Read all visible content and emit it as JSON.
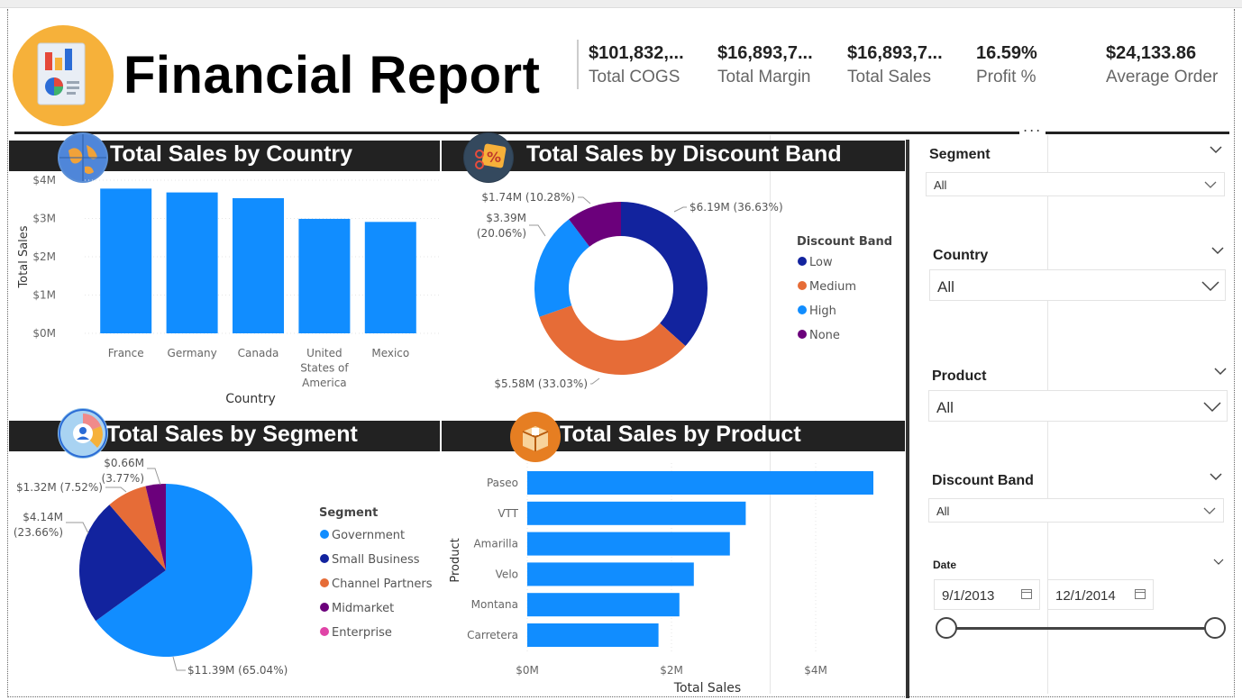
{
  "header": {
    "title": "Financial Report",
    "logo_icon": "report-icon"
  },
  "kpis": [
    {
      "value": "$101,832,...",
      "label": "Total COGS"
    },
    {
      "value": "$16,893,7...",
      "label": "Total Margin"
    },
    {
      "value": "$16,893,7...",
      "label": "Total Sales"
    },
    {
      "value": "16.59%",
      "label": "Profit %"
    },
    {
      "value": "$24,133.86",
      "label": "Average Order"
    }
  ],
  "panels": {
    "country": {
      "title": "Total Sales by Country",
      "icon": "globe-icon"
    },
    "discount": {
      "title": "Total Sales by Discount Band",
      "icon": "discount-tag-icon"
    },
    "segment": {
      "title": "Total Sales by Segment",
      "icon": "pie-user-icon"
    },
    "product": {
      "title": "Total Sales by Product",
      "icon": "box-icon"
    }
  },
  "more_options": "...",
  "colors": {
    "blue": "#118dff",
    "dark_blue": "#12239e",
    "orange": "#e66c37",
    "purple": "#6b007b",
    "pink": "#e044a7",
    "header_bar": "#222222",
    "logo_bg": "#f6b13a"
  },
  "chart_data": [
    {
      "type": "bar",
      "name": "country",
      "categories": [
        "France",
        "Germany",
        "Canada",
        "United States of America",
        "Mexico"
      ],
      "category_lines": [
        [
          "France"
        ],
        [
          "Germany"
        ],
        [
          "Canada"
        ],
        [
          "United",
          "States of",
          "America"
        ],
        [
          "Mexico"
        ]
      ],
      "values": [
        3.78,
        3.68,
        3.53,
        2.99,
        2.91
      ],
      "ylim": [
        0,
        4
      ],
      "yticks": [
        "$0M",
        "$1M",
        "$2M",
        "$3M",
        "$4M"
      ],
      "xlabel": "Country",
      "ylabel": "Total Sales",
      "grid": true
    },
    {
      "type": "pie",
      "name": "discount",
      "donut": true,
      "legend_title": "Discount Band",
      "slices": [
        {
          "name": "Low",
          "value": 6.19,
          "label": "$6.19M (36.63%)",
          "color": "#12239e"
        },
        {
          "name": "Medium",
          "value": 5.58,
          "label": "$5.58M (33.03%)",
          "color": "#e66c37"
        },
        {
          "name": "High",
          "value": 3.39,
          "label": "$3.39M (20.06%)",
          "color": "#118dff"
        },
        {
          "name": "None",
          "value": 1.74,
          "label": "$1.74M (10.28%)",
          "color": "#6b007b"
        }
      ],
      "legend_position": "right"
    },
    {
      "type": "pie",
      "name": "segment",
      "donut": false,
      "legend_title": "Segment",
      "slices": [
        {
          "name": "Government",
          "value": 11.39,
          "label": "$11.39M (65.04%)",
          "color": "#118dff"
        },
        {
          "name": "Small Business",
          "value": 4.14,
          "label": "$4.14M (23.66%)",
          "color": "#12239e"
        },
        {
          "name": "Channel Partners",
          "value": 1.32,
          "label": "$1.32M (7.52%)",
          "color": "#e66c37"
        },
        {
          "name": "Midmarket",
          "value": 0.66,
          "label": "$0.66M (3.77%)",
          "color": "#6b007b"
        },
        {
          "name": "Enterprise",
          "value": 0,
          "label": "",
          "color": "#e044a7"
        }
      ],
      "legend_position": "right"
    },
    {
      "type": "bar",
      "name": "product",
      "orientation": "horizontal",
      "categories": [
        "Paseo",
        "VTT",
        "Amarilla",
        "Velo",
        "Montana",
        "Carretera"
      ],
      "values": [
        4.8,
        3.03,
        2.81,
        2.31,
        2.11,
        1.82
      ],
      "xlim": [
        0,
        5
      ],
      "xticks": [
        {
          "v": 0,
          "t": "$0M"
        },
        {
          "v": 2,
          "t": "$2M"
        },
        {
          "v": 4,
          "t": "$4M"
        }
      ],
      "xlabel": "Total Sales",
      "ylabel": "Product",
      "grid": true
    }
  ],
  "slicers": {
    "segment": {
      "title": "Segment",
      "value": "All"
    },
    "country": {
      "title": "Country",
      "value": "All"
    },
    "product": {
      "title": "Product",
      "value": "All"
    },
    "discount": {
      "title": "Discount Band",
      "value": "All"
    },
    "date": {
      "title": "Date",
      "start": "9/1/2013",
      "end": "12/1/2014",
      "start_fraction": 0,
      "end_fraction": 1
    }
  }
}
